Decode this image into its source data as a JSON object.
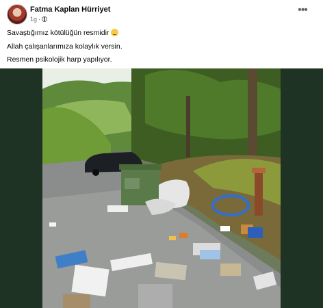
{
  "post": {
    "author": "Fatma Kaplan Hürriyet",
    "time": "1g",
    "separator": "·",
    "privacy_icon": "globe-icon",
    "more_icon": "more-options-icon",
    "more_label": "•••",
    "lines": [
      "Savaştığımız kötülüğün resmidir",
      "Allah çalışanlarımıza kolaylık versin.",
      "Resmen psikolojik harp yapılıyor."
    ],
    "emoji": "thinking-face-emoji"
  },
  "colors": {
    "page_background": "#1f3324",
    "card_background": "#ffffff",
    "text_primary": "#050505",
    "text_secondary": "#65676b"
  }
}
